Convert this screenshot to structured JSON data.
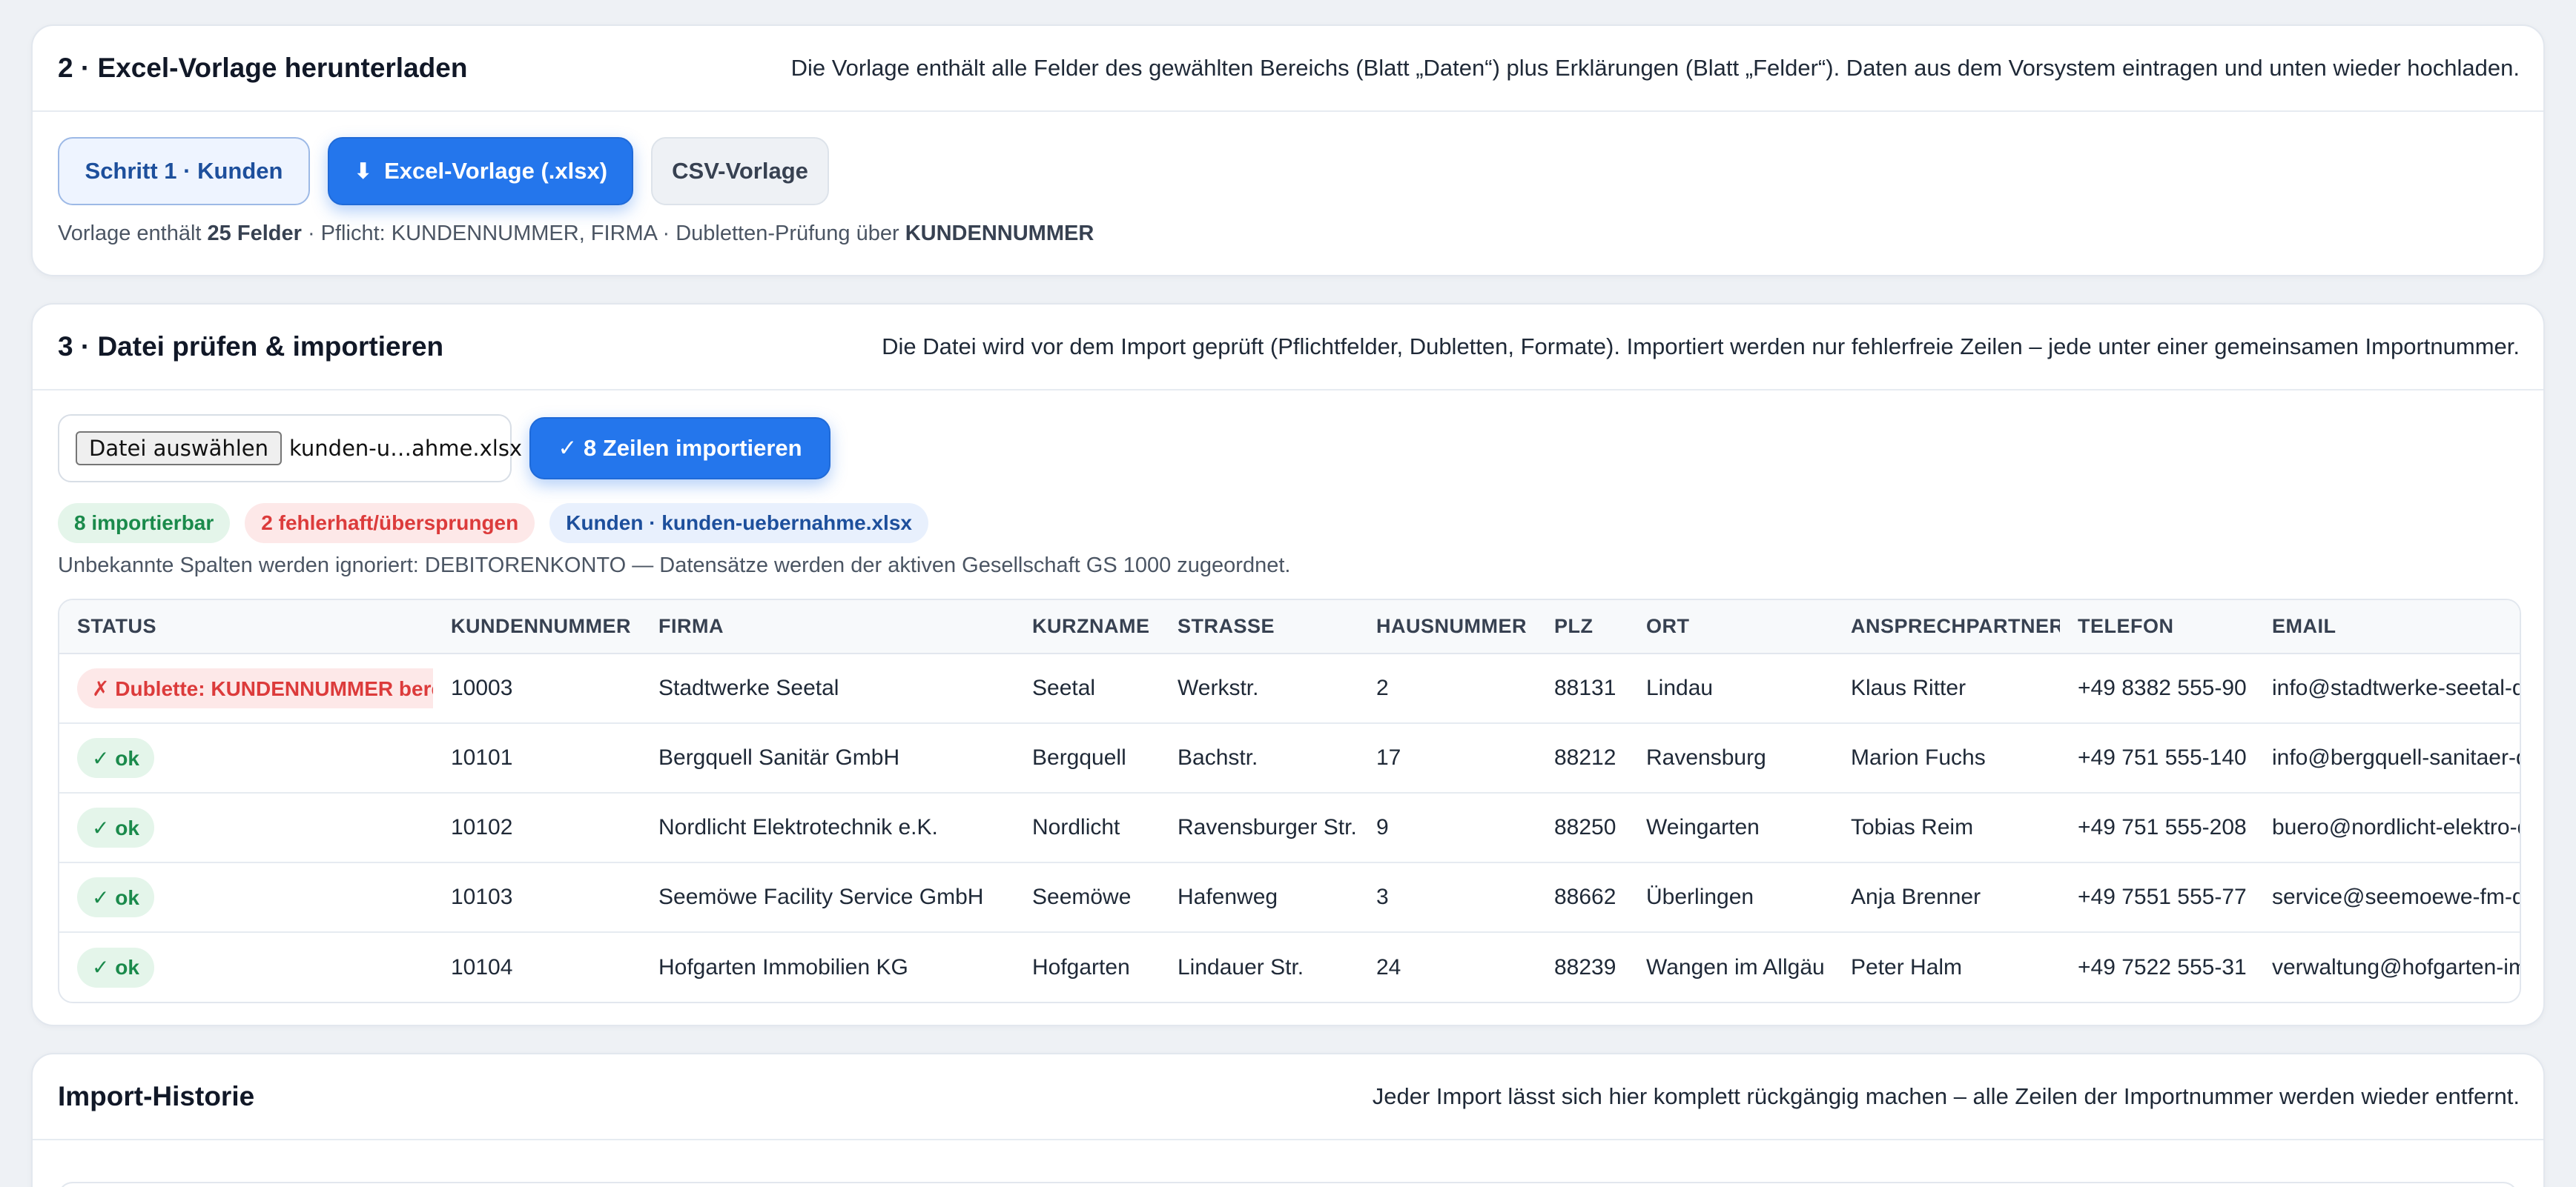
{
  "download_card": {
    "title": "2 · Excel-Vorlage herunterladen",
    "description": "Die Vorlage enthält alle Felder des gewählten Bereichs (Blatt „Daten“) plus Erklärungen (Blatt „Felder“). Daten aus dem Vorsystem eintragen und unten wieder hochladen.",
    "step_button": "Schritt 1 · Kunden",
    "excel_button": "Excel-Vorlage (.xlsx)",
    "csv_button": "CSV-Vorlage",
    "hint": {
      "prefix": "Vorlage enthält ",
      "field_count": "25 Felder",
      "middle": " · Pflicht: KUNDENNUMMER, FIRMA · Dubletten-Prüfung über ",
      "dup_key": "KUNDENNUMMER"
    }
  },
  "import_card": {
    "title": "3 · Datei prüfen & importieren",
    "description": "Die Datei wird vor dem Import geprüft (Pflichtfelder, Dubletten, Formate). Importiert werden nur fehlerfreie Zeilen – jede unter einer gemeinsamen Importnummer.",
    "file_button": "Datei auswählen",
    "file_name": "kunden-u…ahme.xlsx",
    "import_button": "✓ 8 Zeilen importieren",
    "badges": {
      "importable": "8 importierbar",
      "faulty": "2 fehlerhaft/übersprungen",
      "source": "Kunden · kunden-uebernahme.xlsx"
    },
    "note": "Unbekannte Spalten werden ignoriert: DEBITORENKONTO — Datensätze werden der aktiven Gesellschaft GS 1000 zugeordnet.",
    "table": {
      "headers": [
        "STATUS",
        "KUNDENNUMMER",
        "FIRMA",
        "KURZNAME",
        "STRASSE",
        "HAUSNUMMER",
        "PLZ",
        "ORT",
        "ANSPRECHPARTNER",
        "TELEFON",
        "EMAIL"
      ],
      "rows": [
        {
          "status": "✗ Dublette: KUNDENNUMMER bereits vorhanden",
          "status_type": "error",
          "cells": [
            "10003",
            "Stadtwerke Seetal",
            "Seetal",
            "Werkstr.",
            "2",
            "88131",
            "Lindau",
            "Klaus Ritter",
            "+49 8382 555-90",
            "info@stadtwerke-seetal-de"
          ]
        },
        {
          "status": "✓ ok",
          "status_type": "ok",
          "cells": [
            "10101",
            "Bergquell Sanitär GmbH",
            "Bergquell",
            "Bachstr.",
            "17",
            "88212",
            "Ravensburg",
            "Marion Fuchs",
            "+49 751 555-140",
            "info@bergquell-sanitaer-de"
          ]
        },
        {
          "status": "✓ ok",
          "status_type": "ok",
          "cells": [
            "10102",
            "Nordlicht Elektrotechnik e.K.",
            "Nordlicht",
            "Ravensburger Str.",
            "9",
            "88250",
            "Weingarten",
            "Tobias Reim",
            "+49 751 555-208",
            "buero@nordlicht-elektro-de"
          ]
        },
        {
          "status": "✓ ok",
          "status_type": "ok",
          "cells": [
            "10103",
            "Seemöwe Facility Service GmbH",
            "Seemöwe",
            "Hafenweg",
            "3",
            "88662",
            "Überlingen",
            "Anja Brenner",
            "+49 7551 555-77",
            "service@seemoewe-fm-de"
          ]
        },
        {
          "status": "✓ ok",
          "status_type": "ok",
          "cells": [
            "10104",
            "Hofgarten Immobilien KG",
            "Hofgarten",
            "Lindauer Str.",
            "24",
            "88239",
            "Wangen im Allgäu",
            "Peter Halm",
            "+49 7522 555-31",
            "verwaltung@hofgarten-imm"
          ]
        }
      ]
    }
  },
  "history_card": {
    "title": "Import-Historie",
    "description": "Jeder Import lässt sich hier komplett rückgängig machen – alle Zeilen der Importnummer werden wieder entfernt."
  },
  "colors": {
    "primary": "#2476ec",
    "ok_text": "#1a8a4b",
    "ok_bg": "#e4f5ea",
    "error_text": "#dc3b3b",
    "error_bg": "#fde8e8"
  }
}
